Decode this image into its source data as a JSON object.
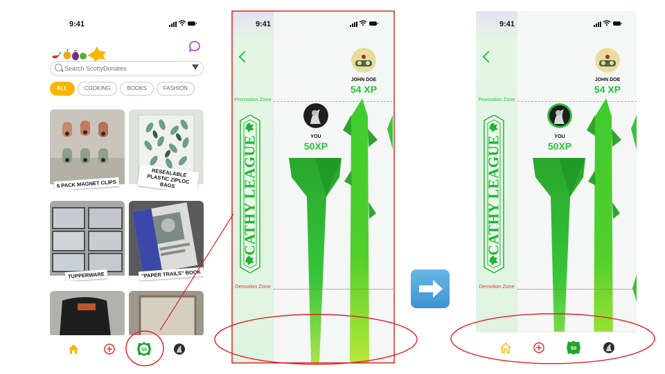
{
  "status_bar": {
    "time": "9:41"
  },
  "home": {
    "search": {
      "placeholder": "Search ScottyDonates"
    },
    "categories": [
      "ALL",
      "COOKING",
      "BOOKS",
      "FASHION"
    ],
    "active_category": "ALL",
    "listings": [
      {
        "title": "6 PACK MAGNET CLIPS"
      },
      {
        "title": "RESEALABLE PLASTIC ZIPLOC BAGS"
      },
      {
        "title": "TUPPERWARE"
      },
      {
        "title": "\"PAPER TRAILS\" BOOK"
      }
    ],
    "tab_bar": {
      "badge": "50"
    }
  },
  "leaderboard": {
    "league_name": "CATHY LEAGUE",
    "promotion_zone": "Promotion Zone",
    "demotion_zone": "Demotion Zone",
    "players": [
      {
        "name": "JOHN DOE",
        "xp": "54 XP"
      },
      {
        "name": "YOU",
        "xp": "50XP"
      }
    ],
    "tab_bar": {
      "badge": "50"
    }
  },
  "colors": {
    "brand_yellow": "#f7b500",
    "league_green": "#22c33a",
    "annotation_red": "#e02020",
    "promotion_line": "#7ad38a",
    "demotion_line": "#e04545"
  },
  "icons": [
    "logo-icon",
    "chat-icon",
    "search-icon",
    "filter-icon",
    "home-icon",
    "add-icon",
    "xp-badge-icon",
    "profile-avatar-icon",
    "back-chevron-icon",
    "arrow-right-icon"
  ]
}
